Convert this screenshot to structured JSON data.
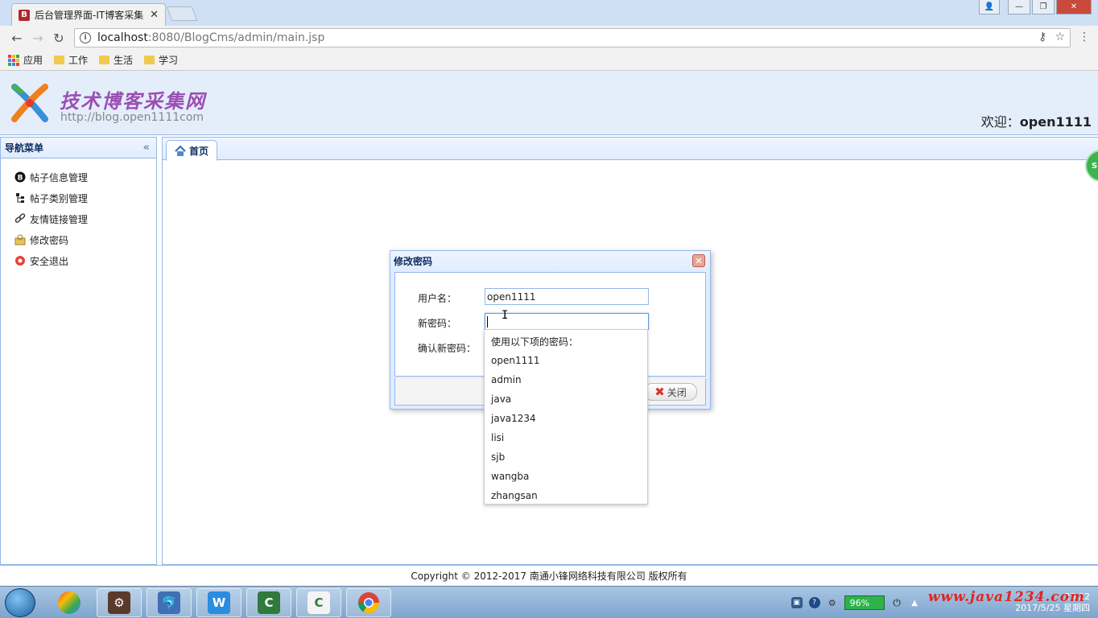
{
  "browser": {
    "tab_title": "后台管理界面-IT博客采集",
    "tab_favicon": "B",
    "url_host": "localhost",
    "url_rest": ":8080/BlogCms/admin/main.jsp",
    "bookmarks": [
      "应用",
      "工作",
      "生活",
      "学习"
    ]
  },
  "header": {
    "logo_title": "技术博客采集网",
    "logo_url": "http://blog.open1111com",
    "welcome_label": "欢迎：",
    "username": "open1111"
  },
  "nav": {
    "title": "导航菜单",
    "items": [
      {
        "label": "帖子信息管理",
        "icon": "blog-icon"
      },
      {
        "label": "帖子类别管理",
        "icon": "tree-icon"
      },
      {
        "label": "友情链接管理",
        "icon": "link-icon"
      },
      {
        "label": "修改密码",
        "icon": "key-icon"
      },
      {
        "label": "安全退出",
        "icon": "exit-icon"
      }
    ]
  },
  "tabs": {
    "home_label": "首页"
  },
  "dialog": {
    "title": "修改密码",
    "username_label": "用户名：",
    "username_value": "open1111",
    "newpass_label": "新密码：",
    "confirm_label": "确认新密码：",
    "close_button": "关闭"
  },
  "autocomplete": {
    "header": "使用以下项的密码：",
    "items": [
      "open1111",
      "admin",
      "java",
      "java1234",
      "lisi",
      "sjb",
      "wangba",
      "zhangsan"
    ]
  },
  "footer": {
    "copyright": "Copyright © 2012-2017 南通小锋网络科技有限公司 版权所有"
  },
  "taskbar": {
    "battery": "96%",
    "time": "23:22",
    "date": "2017/5/25 星期四",
    "watermark": "www.java1234.com"
  },
  "colors": {
    "panel_border": "#95b8e7",
    "header_bg": "#e4eefb",
    "logo_text": "#9b4fb3"
  }
}
